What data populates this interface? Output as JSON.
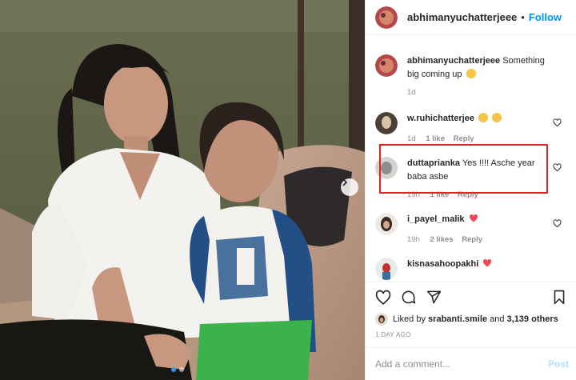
{
  "post": {
    "author": "abhimanyuchatterjeee",
    "separator": "•",
    "follow_label": "Follow",
    "caption": "Something big coming up",
    "caption_age": "1d",
    "photo_icons": {
      "next": "chevron-right-icon"
    }
  },
  "comments": [
    {
      "user": "w.ruhichatterjee",
      "text": "",
      "emojis": [
        "heart-eyes-emoji",
        "heart-eyes-emoji"
      ],
      "age": "1d",
      "likes": "1 like",
      "reply": "Reply"
    },
    {
      "user": "duttaprianka",
      "text": "Yes !!!! Asche year baba asbe",
      "age": "19h",
      "likes": "1 like",
      "reply": "Reply"
    },
    {
      "user": "i_payel_malik",
      "text": "",
      "emojis": [
        "red-heart-emoji"
      ],
      "age": "19h",
      "likes": "2 likes",
      "reply": "Reply"
    },
    {
      "user": "kisnasahoopakhi",
      "text": "",
      "emojis": [
        "red-heart-emoji"
      ],
      "age": "",
      "likes": "",
      "reply": ""
    }
  ],
  "likes": {
    "prefix": "Liked by",
    "user": "srabanti.smile",
    "mid": "and",
    "count": "3,139 others"
  },
  "timestamp": "1 DAY AGO",
  "add_comment": {
    "placeholder": "Add a comment...",
    "post_label": "Post"
  },
  "icons": [
    "heart-icon",
    "comment-icon",
    "share-icon",
    "bookmark-icon"
  ],
  "colors": {
    "link": "#0095f6",
    "highlight": "#e0211f",
    "muted": "#8e8e8e",
    "heart": "#ed4956"
  }
}
